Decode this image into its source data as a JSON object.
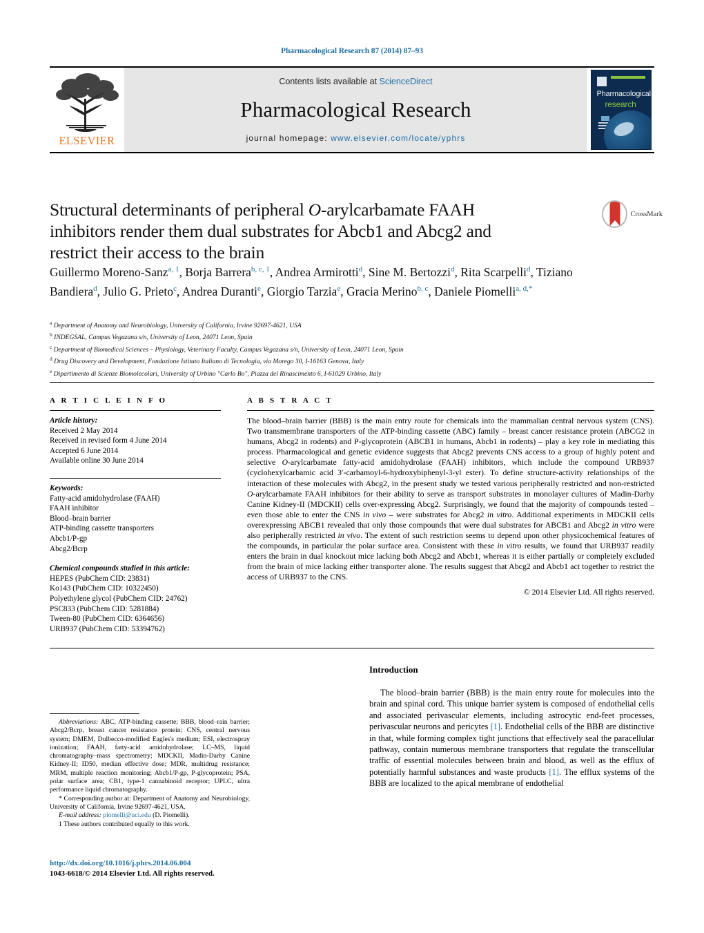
{
  "running_head": "Pharmacological Research 87 (2014) 87–93",
  "masthead": {
    "publisher_name": "ELSEVIER",
    "contents_prefix": "Contents lists available at ",
    "contents_link": "ScienceDirect",
    "journal_title": "Pharmacological Research",
    "homepage_prefix": "journal homepage: ",
    "homepage_url": "www.elsevier.com/locate/yphrs",
    "cover": {
      "line1": "Pharmacological",
      "line2": "research"
    }
  },
  "crossmark": {
    "label": "CrossMark"
  },
  "article": {
    "title_line1_a": "Structural determinants of peripheral ",
    "title_line1_ital": "O",
    "title_line1_b": "-arylcarbamate FAAH",
    "title_line2": "inhibitors render them dual substrates for Abcb1 and Abcg2 and",
    "title_line3": "restrict their access to the brain",
    "authors_html": "Guillermo Moreno-Sanz<sup>a, 1</sup>, Borja Barrera<sup>b, c, 1</sup>, Andrea Armirotti<sup>d</sup>, Sine M. Bertozzi<sup>d</sup>, Rita Scarpelli<sup>d</sup>, Tiziano Bandiera<sup>d</sup>, Julio G. Prieto<sup>c</sup>, Andrea Duranti<sup>e</sup>, Giorgio Tarzia<sup>e</sup>, Gracia Merino<sup>b, c</sup>, Daniele Piomelli<sup>a, d,</sup><sup>*</sup>",
    "affiliations": [
      {
        "mark": "a",
        "text": "Department of Anatomy and Neurobiology, University of California, Irvine 92697-4621, USA"
      },
      {
        "mark": "b",
        "text": "INDEGSAL, Campus Vegazana s/n, University of Leon, 24071 Leon, Spain"
      },
      {
        "mark": "c",
        "text": "Department of Biomedical Sciences – Physiology, Veterinary Faculty, Campus Vegazana s/n, University of Leon, 24071 Leon, Spain"
      },
      {
        "mark": "d",
        "text": "Drug Discovery and Development, Fondazione Istituto Italiano di Tecnologia, via Morego 30, I-16163 Genova, Italy"
      },
      {
        "mark": "e",
        "text": "Dipartimento di Scienze Biomolecolari, University of Urbino \"Carlo Bo\", Piazza del Rinascimento 6, I-61029 Urbino, Italy"
      }
    ]
  },
  "article_info": {
    "heading": "A R T I C L E   I N F O",
    "history_label": "Article history:",
    "history": [
      "Received 2 May 2014",
      "Received in revised form 4 June 2014",
      "Accepted 6 June 2014",
      "Available online 30 June 2014"
    ],
    "keywords_label": "Keywords:",
    "keywords": [
      "Fatty-acid amidohydrolase (FAAH)",
      "FAAH inhibitor",
      "Blood–brain barrier",
      "ATP-binding cassette transporters",
      "Abcb1/P-gp",
      "Abcg2/Bcrp"
    ],
    "compounds_label": "Chemical compounds studied in this article:",
    "compounds": [
      "HEPES (PubChem CID: 23831)",
      "Ko143 (PubChem CID: 10322450)",
      "Polyethylene glycol (PubChem CID: 24762)",
      "PSC833 (PubChem CID: 5281884)",
      "Tween-80 (PubChem CID: 6364656)",
      "URB937 (PubChem CID: 53394762)"
    ]
  },
  "abstract": {
    "heading": "A B S T R A C T",
    "body_html": "The blood–brain barrier (BBB) is the main entry route for chemicals into the mammalian central nervous system (CNS). Two transmembrane transporters of the ATP-binding cassette (ABC) family – breast cancer resistance protein (ABCG2 in humans, Abcg2 in rodents) and P-glycoprotein (ABCB1 in humans, Abcb1 in rodents) – play a key role in mediating this process. Pharmacological and genetic evidence suggests that Abcg2 prevents CNS access to a group of highly potent and selective <span class=\"it\">O</span>-arylcarbamate fatty-acid amidohydrolase (FAAH) inhibitors, which include the compound URB937 (cyclohexylcarbamic acid 3′-carbamoyl-6-hydroxybiphenyl-3-yl ester). To define structure-activity relationships of the interaction of these molecules with Abcg2, in the present study we tested various peripherally restricted and non-restricted <span class=\"it\">O</span>-arylcarbamate FAAH inhibitors for their ability to serve as transport substrates in monolayer cultures of Madin-Darby Canine Kidney-II (MDCKII) cells over-expressing Abcg2. Surprisingly, we found that the majority of compounds tested – even those able to enter the CNS <span class=\"it\">in vivo</span> – were substrates for Abcg2 <span class=\"it\">in vitro</span>. Additional experiments in MDCKII cells overexpressing ABCB1 revealed that only those compounds that were dual substrates for ABCB1 and Abcg2 <span class=\"it\">in vitro</span> were also peripherally restricted <span class=\"it\">in vivo</span>. The extent of such restriction seems to depend upon other physicochemical features of the compounds, in particular the polar surface area. Consistent with these <span class=\"it\">in vitro</span> results, we found that URB937 readily enters the brain in dual knockout mice lacking both Abcg2 and Abcb1, whereas it is either partially or completely excluded from the brain of mice lacking either transporter alone. The results suggest that Abcg2 and Abcb1 act together to restrict the access of URB937 to the CNS.",
    "copyright": "© 2014 Elsevier Ltd. All rights reserved."
  },
  "footnotes": {
    "abbreviations_label": "Abbreviations:",
    "abbreviations_text": " ABC, ATP-binding cassette; BBB, blood–rain barrier; Abcg2/Bcrp, breast cancer resistance protein; CNS, central nervous system; DMEM, Dulbecco-modified Eagles's medium; ESI, electrospray ionization; FAAH, fatty-acid amidohydrolase; LC–MS, liquid chromatography–mass spectrometry; MDCKII, Madin-Darby Canine Kidney-II; ID50, median effective dose; MDR, multidrug resistance; MRM, multiple reaction monitoring; Abcb1/P-gp, P-glycoprotein; PSA, polar surface area; CB1, type-1 cannabinoid receptor; UPLC, ultra performance liquid chromatography.",
    "corresponding": "* Corresponding author at: Department of Anatomy and Neurobiology, University of California, Irvine 92697-4621, USA.",
    "email_label": "E-mail address:",
    "email": "piomelli@uci.edu",
    "email_suffix": " (D. Piomelli).",
    "equal_contrib": "1  These authors contributed equally to this work."
  },
  "doi_block": {
    "doi_url": "http://dx.doi.org/10.1016/j.phrs.2014.06.004",
    "issn_line": "1043-6618/© 2014 Elsevier Ltd. All rights reserved."
  },
  "introduction": {
    "heading": "Introduction",
    "paragraph_html": "The blood–brain barrier (BBB) is the main entry route for molecules into the brain and spinal cord. This unique barrier system is composed of endothelial cells and associated perivascular elements, including astrocytic end-feet processes, perivascular neurons and pericytes <span class=\"ref\">[1]</span>. Endothelial cells of the BBB are distinctive in that, while forming complex tight junctions that effectively seal the paracellular pathway, contain numerous membrane transporters that regulate the transcellular traffic of essential molecules between brain and blood, as well as the efflux of potentially harmful substances and waste products <span class=\"ref\">[1]</span>. The efflux systems of the BBB are localized to the apical membrane of endothelial"
  },
  "colors": {
    "link": "#1c6ea4",
    "elsevier_orange": "#E87722",
    "masthead_bg": "#e6e6e6",
    "cover_bg": "#0d2b4e",
    "cover_green": "#8bc53f",
    "crossmark_red": "#d0342c"
  }
}
